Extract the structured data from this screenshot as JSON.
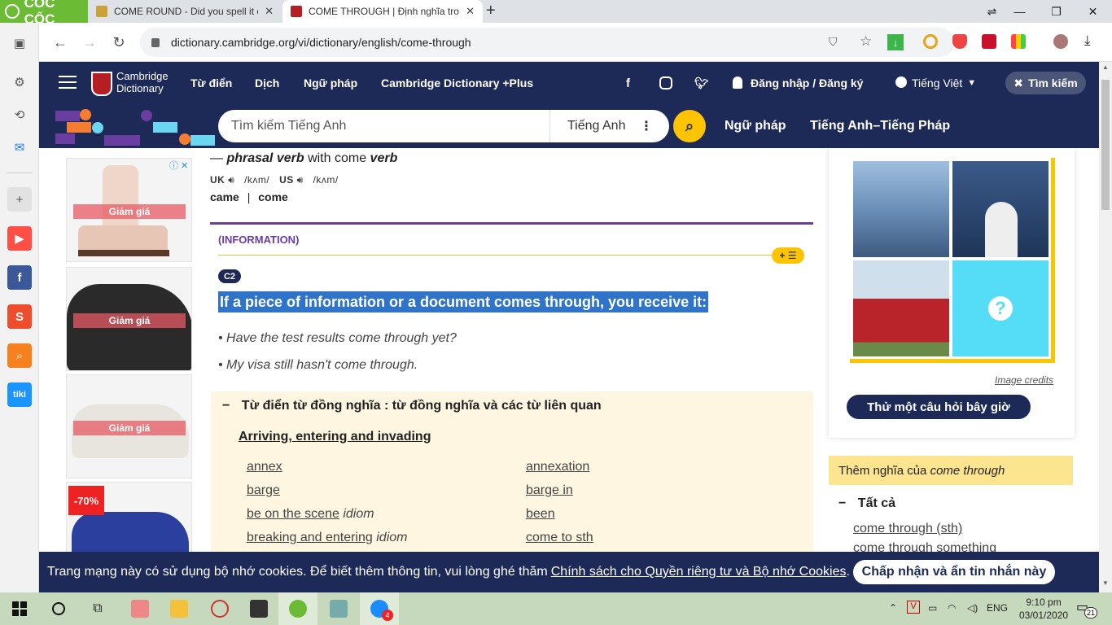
{
  "browser": {
    "brand": "CỐC CỐC",
    "tabs": [
      {
        "title": "COME ROUND - Did you spell it correctly",
        "active": false
      },
      {
        "title": "COME THROUGH | Định nghĩa trong từ điển",
        "active": true
      }
    ],
    "new_tab": "+",
    "url": "dictionary.cambridge.org/vi/dictionary/english/come-through",
    "colors": {
      "brand": "#6bbb34",
      "tabbar": "#dee1e6"
    }
  },
  "header": {
    "brand_line1": "Cambridge",
    "brand_line2": "Dictionary",
    "nav": [
      "Từ điển",
      "Dịch",
      "Ngữ pháp",
      "Cambridge Dictionary +Plus"
    ],
    "login": "Đăng nhập / Đăng ký",
    "language": "Tiếng Việt",
    "search_button": "Tìm kiếm",
    "colors": {
      "navy": "#1d2a57",
      "yellow": "#fec400"
    }
  },
  "search": {
    "placeholder": "Tìm kiếm Tiếng Anh",
    "language": "Tiếng Anh",
    "links": [
      "Ngữ pháp",
      "Tiếng Anh–Tiếng Pháp"
    ]
  },
  "ads": [
    {
      "label": "Giảm giá",
      "badge": ""
    },
    {
      "label": "Giảm giá",
      "badge": ""
    },
    {
      "label": "Giảm giá",
      "badge": ""
    },
    {
      "label": "",
      "badge": "-70%"
    }
  ],
  "entry": {
    "pos_dash": "—",
    "pos_phrasal": "phrasal verb",
    "pos_with": "with come",
    "pos_verb": "verb",
    "uk": "UK",
    "uk_ipa": "/kʌm/",
    "us": "US",
    "us_ipa": "/kʌm/",
    "form1": "came",
    "form_sep": "|",
    "form2": "come",
    "guideword": "(INFORMATION)",
    "level": "C2",
    "definition": "If a piece of information or a document comes through, you receive it:",
    "examples": [
      "Have the test results come through yet?",
      "My visa still hasn't come through."
    ]
  },
  "thesaurus": {
    "toggle": "−",
    "title": "Từ điển từ đồng nghĩa : từ đồng nghĩa và các từ liên quan",
    "category": "Arriving, entering and invading",
    "left": [
      {
        "word": "annex",
        "tag": ""
      },
      {
        "word": "barge",
        "tag": ""
      },
      {
        "word": "be on the scene",
        "tag": "idiom"
      },
      {
        "word": "breaking and entering",
        "tag": "idiom"
      }
    ],
    "right": [
      {
        "word": "annexation",
        "tag": ""
      },
      {
        "word": "barge in",
        "tag": ""
      },
      {
        "word": "been",
        "tag": ""
      },
      {
        "word": "come to sth",
        "tag": ""
      }
    ]
  },
  "sidebar_right": {
    "image_credits": "Image credits",
    "try_quiz": "Thử một câu hỏi bây giờ",
    "question_mark": "?",
    "more_prefix": "Thêm nghĩa của",
    "more_term": "come through",
    "all_toggle": "−",
    "all_label": "Tất cả",
    "links": [
      "come through (sth)",
      "come through something"
    ]
  },
  "cookie": {
    "text": "Trang mạng này có sử dụng bộ nhớ cookies. Để biết thêm thông tin, vui lòng ghé thăm",
    "link": "Chính sách cho Quyền riêng tư và Bộ nhớ Cookies",
    "period": ".",
    "accept": "Chấp nhận và ẩn tin nhắn này"
  },
  "taskbar": {
    "lang": "ENG",
    "time": "9:10 pm",
    "date": "03/01/2020",
    "notif_count": "21",
    "zalo_badge": "4"
  }
}
